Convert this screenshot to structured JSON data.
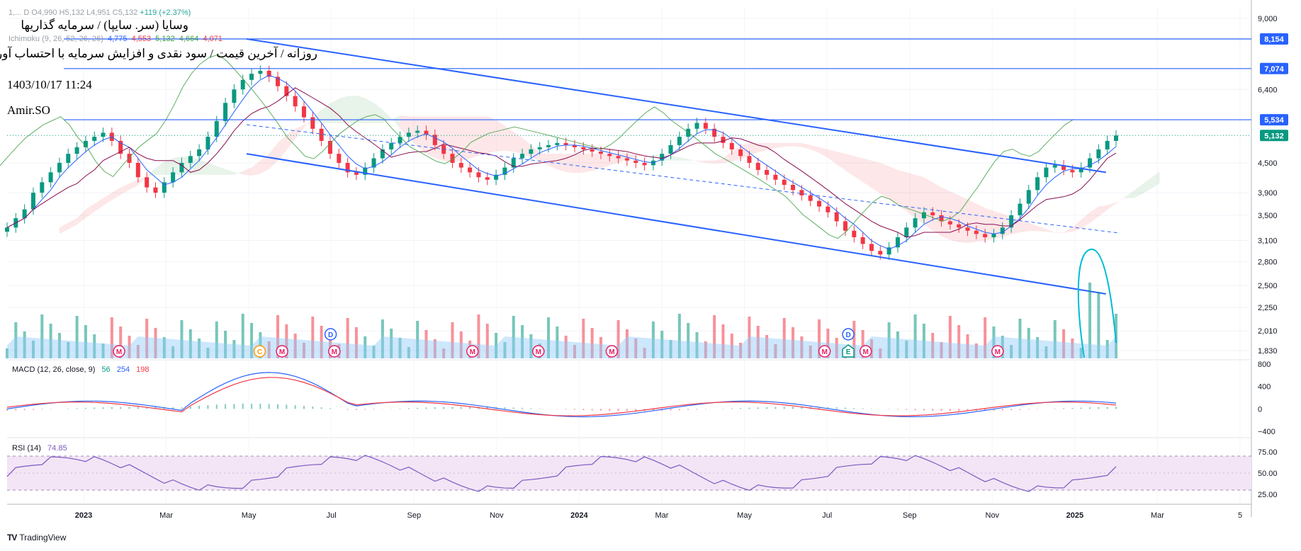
{
  "header": {
    "ohlc_line": "1,...  D  O4,990  H5,132  L4,951  C5,132",
    "change": "+119 (+2.37%)",
    "title_line1": "وسایا (سر. سایپا) / سرمایه گذاریها",
    "title_line2": "روزانه / آخرین قیمت / سود نقدی و افزایش سرمایه با احتساب آورده",
    "timestamp": "1403/10/17 11:24",
    "author": "Amir.SO",
    "ichimoku_label": "Ichimoku (9, 26, 52, 26, 26)",
    "ichimoku_values": [
      "4,775",
      "4,553",
      "5,132",
      "4,664",
      "4,071"
    ]
  },
  "branding": {
    "logo": "TV",
    "name": "TradingView"
  },
  "colors": {
    "up": "#089981",
    "down": "#f23645",
    "tenkan": "#2962ff",
    "kijun": "#880e4f",
    "lagging": "#43a047",
    "trend": "#2962ff",
    "macd": "#2962ff",
    "signal": "#f23645",
    "rsi": "#7e57c2",
    "rsi_band": "#f3e5f5",
    "volume_ma": "#90caf9",
    "ellipse": "#00bcd4"
  },
  "chart_data": [
    {
      "type": "candlestick",
      "title": "وسایا (سر. سایپا) / سرمایه گذاریها",
      "x_ticks": [
        "2023",
        "Mar",
        "May",
        "Jul",
        "Sep",
        "Nov",
        "2024",
        "Mar",
        "May",
        "Jul",
        "Sep",
        "Nov",
        "2025",
        "Mar",
        "5"
      ],
      "y_ticks": [
        9000,
        6400,
        4500,
        3900,
        3500,
        3100,
        2800,
        2500,
        2250,
        2010,
        1830
      ],
      "y_scale": "log",
      "ylim": [
        1750,
        9500
      ],
      "price_levels": [
        {
          "value": 8154,
          "label": "8,154",
          "color": "#2962ff"
        },
        {
          "value": 7074,
          "label": "7,074",
          "color": "#2962ff"
        },
        {
          "value": 5534,
          "label": "5,534",
          "color": "#2962ff"
        },
        {
          "value": 5132,
          "label": "5,132",
          "color": "#089981"
        }
      ],
      "close_series": [
        3300,
        3450,
        3600,
        3900,
        4100,
        4300,
        4500,
        4700,
        4850,
        5000,
        5100,
        5200,
        5000,
        4700,
        4500,
        4200,
        4000,
        3900,
        4100,
        4300,
        4500,
        4650,
        4800,
        5100,
        5500,
        6000,
        6400,
        6700,
        6900,
        7000,
        6800,
        6500,
        6200,
        5900,
        5600,
        5300,
        5000,
        4700,
        4500,
        4300,
        4250,
        4400,
        4600,
        4800,
        4950,
        5100,
        5200,
        5250,
        5150,
        4900,
        4700,
        4500,
        4400,
        4300,
        4200,
        4150,
        4250,
        4400,
        4600,
        4700,
        4800,
        4850,
        4900,
        4950,
        4900,
        4850,
        4800,
        4750,
        4700,
        4650,
        4600,
        4550,
        4500,
        4450,
        4550,
        4700,
        4900,
        5100,
        5300,
        5450,
        5300,
        5100,
        4950,
        4800,
        4650,
        4500,
        4350,
        4250,
        4150,
        4050,
        3950,
        3850,
        3750,
        3650,
        3550,
        3400,
        3250,
        3150,
        3050,
        2950,
        2900,
        3000,
        3150,
        3300,
        3450,
        3550,
        3500,
        3400,
        3350,
        3300,
        3250,
        3200,
        3150,
        3200,
        3300,
        3500,
        3700,
        3950,
        4200,
        4400,
        4450,
        4350,
        4300,
        4400,
        4600,
        4800,
        5000,
        5132
      ],
      "trend_upper": [
        {
          "date": "2023-04-25",
          "value": 8154
        },
        {
          "date": "2025-01-12",
          "value": 4300
        }
      ],
      "trend_lower": [
        {
          "date": "2023-04-25",
          "value": 4700
        },
        {
          "date": "2025-01-12",
          "value": 2400
        }
      ]
    },
    {
      "type": "line",
      "title": "MACD (12, 26, close, 9)",
      "values": [
        "56",
        "254",
        "198"
      ],
      "y_ticks": [
        800,
        400,
        0,
        -400
      ],
      "ylim": [
        -500,
        850
      ]
    },
    {
      "type": "line",
      "title": "RSI (14)",
      "values": [
        "74.85"
      ],
      "y_ticks": [
        75,
        50,
        25
      ],
      "ylim": [
        15,
        90
      ],
      "bands": [
        30,
        70
      ]
    }
  ],
  "event_markers": [
    {
      "kind": "circle",
      "label": "M",
      "color": "#e91e63",
      "slot": 0.09
    },
    {
      "kind": "circle",
      "label": "C",
      "color": "#ff9800",
      "slot": 0.203
    },
    {
      "kind": "circle",
      "label": "M",
      "color": "#e91e63",
      "slot": 0.221
    },
    {
      "kind": "circle",
      "label": "D",
      "color": "#2962ff",
      "slot": 0.26,
      "raised": true
    },
    {
      "kind": "circle",
      "label": "M",
      "color": "#e91e63",
      "slot": 0.263
    },
    {
      "kind": "circle",
      "label": "M",
      "color": "#e91e63",
      "slot": 0.374
    },
    {
      "kind": "circle",
      "label": "M",
      "color": "#e91e63",
      "slot": 0.427
    },
    {
      "kind": "circle",
      "label": "M",
      "color": "#e91e63",
      "slot": 0.486
    },
    {
      "kind": "circle",
      "label": "M",
      "color": "#e91e63",
      "slot": 0.657
    },
    {
      "kind": "circle",
      "label": "D",
      "color": "#2962ff",
      "slot": 0.676,
      "raised": true
    },
    {
      "kind": "pentagon",
      "label": "E",
      "color": "#089981",
      "slot": 0.676
    },
    {
      "kind": "circle",
      "label": "M",
      "color": "#e91e63",
      "slot": 0.69
    },
    {
      "kind": "circle",
      "label": "M",
      "color": "#e91e63",
      "slot": 0.796
    }
  ]
}
